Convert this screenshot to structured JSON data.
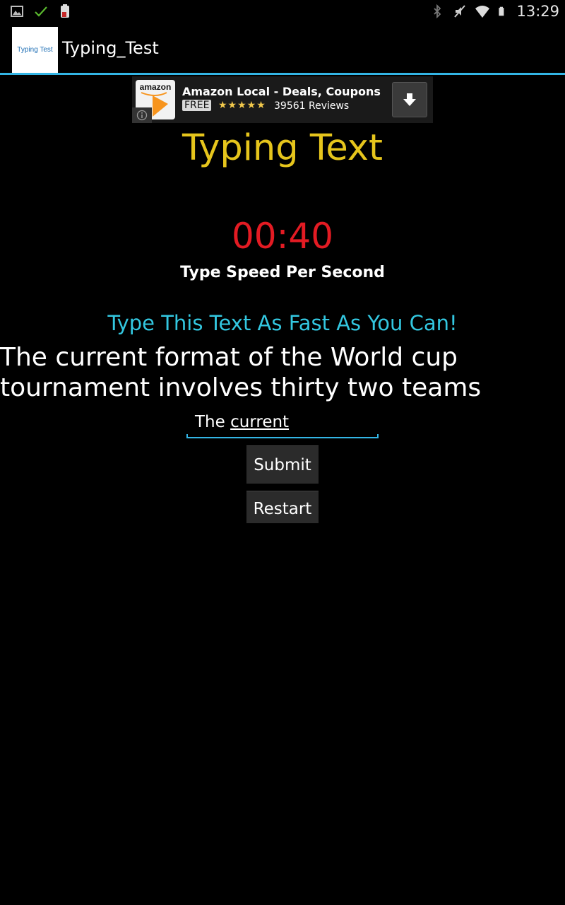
{
  "status_bar": {
    "time": "13:29",
    "icons_left": [
      "image-icon",
      "check-icon",
      "battery-alert-icon"
    ],
    "icons_right": [
      "bluetooth-icon",
      "mute-icon",
      "wifi-icon",
      "battery-icon"
    ]
  },
  "action_bar": {
    "app_icon_text": "Typing Test",
    "title": "Typing_Test",
    "accent_color": "#33b5e5"
  },
  "ad": {
    "logo_text": "amazon",
    "title": "Amazon Local - Deals, Coupons",
    "badge": "FREE",
    "stars": "★★★★★",
    "rating": 4.5,
    "reviews": "39561 Reviews"
  },
  "main": {
    "heading": "Typing Text",
    "timer": "00:40",
    "speed_label": "Type Speed Per Second",
    "instruction": "Type This Text As Fast As You Can!",
    "passage": "The current format of the World cup tournament involves thirty two teams",
    "input": {
      "value_plain": "The ",
      "value_underlined": "current"
    },
    "buttons": {
      "submit": "Submit",
      "restart": "Restart"
    }
  },
  "colors": {
    "heading": "#e6c51c",
    "timer": "#e31b23",
    "instruction": "#33c7e0",
    "background": "#000000"
  }
}
